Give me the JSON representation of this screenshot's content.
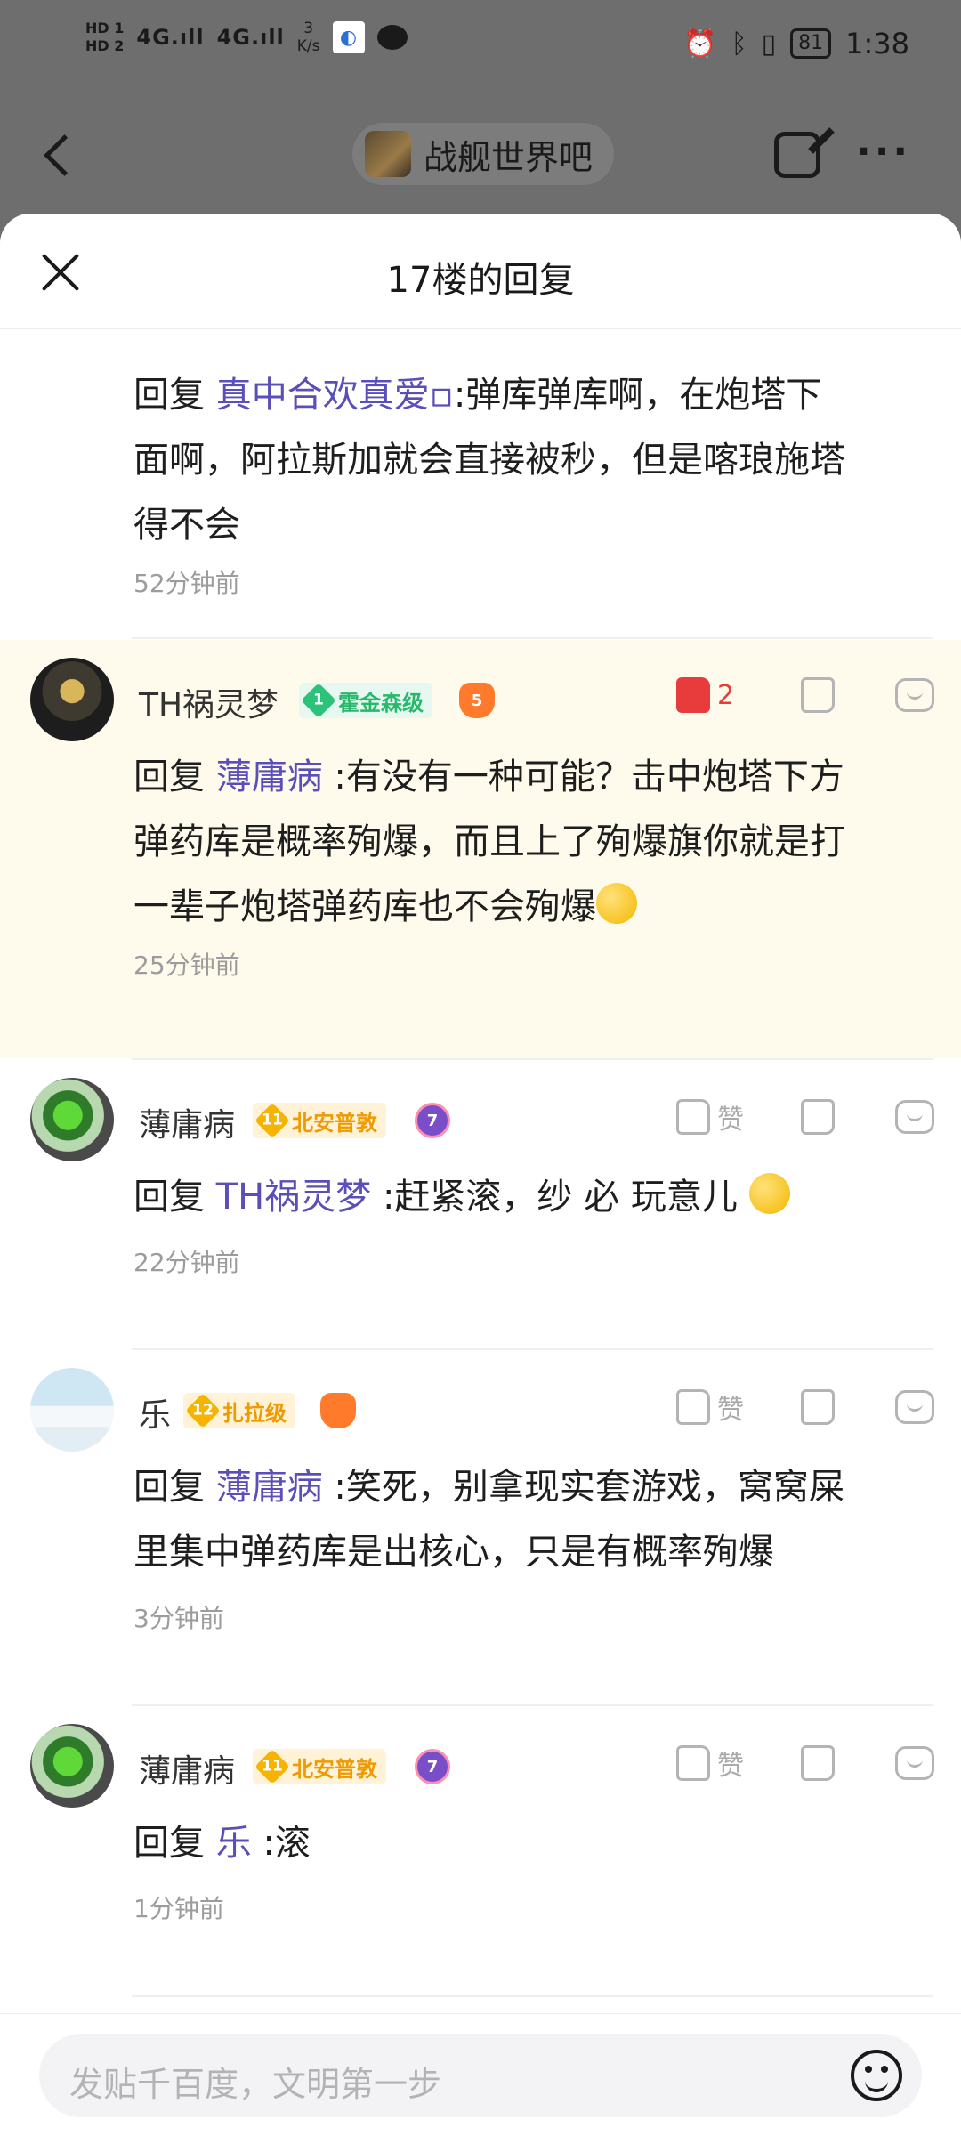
{
  "status_bar": {
    "hd1": "HD 1",
    "hd2": "HD 2",
    "signal1": "4G.ıll",
    "signal2": "4G.ıll",
    "speed_value": "3",
    "speed_unit": "K/s",
    "battery": "81",
    "time": "1:38",
    "icons": [
      "alarm-icon",
      "bluetooth-icon",
      "vibrate-icon",
      "battery-icon"
    ]
  },
  "nav": {
    "forum_name": "战舰世界吧"
  },
  "sheet": {
    "title": "17楼的回复"
  },
  "replies": [
    {
      "reply_prefix": "回复 ",
      "mention": "真中合欢真爱▫",
      "text_lines": [
        ":弹库弹库啊，在炮塔下",
        "面啊，阿拉斯加就会直接被秒，但是喀琅施塔",
        "得不会"
      ],
      "time": "52分钟前"
    },
    {
      "username": "TH祸灵梦",
      "level": "1",
      "badge": "霍金森级",
      "game_level": "5",
      "likes": "2",
      "reply_prefix": "回复 ",
      "mention": "薄庸病",
      "text_lines": [
        " :有没有一种可能？击中炮塔下方",
        "弹药库是概率殉爆，而且上了殉爆旗你就是打",
        "一辈子炮塔弹药库也不会殉爆"
      ],
      "time": "25分钟前"
    },
    {
      "username": "薄庸病",
      "level": "11",
      "badge": "北安普敦",
      "game_level": "7",
      "like_label": "赞",
      "reply_prefix": "回复 ",
      "mention": "TH祸灵梦",
      "text_lines": [
        " :赶紧滚，纱 必 玩意儿"
      ],
      "time": "22分钟前"
    },
    {
      "username": "乐",
      "level": "12",
      "badge": "扎拉级",
      "like_label": "赞",
      "reply_prefix": "回复 ",
      "mention": "薄庸病",
      "text_lines": [
        " :笑死，别拿现实套游戏，窝窝屎",
        "里集中弹药库是出核心，只是有概率殉爆"
      ],
      "time": "3分钟前"
    },
    {
      "username": "薄庸病",
      "level": "11",
      "badge": "北安普敦",
      "game_level": "7",
      "like_label": "赞",
      "reply_prefix": "回复 ",
      "mention": "乐",
      "text_lines": [
        " :滚"
      ],
      "time": "1分钟前"
    }
  ],
  "input": {
    "placeholder": "发贴千百度，文明第一步"
  },
  "colors": {
    "mention": "#5a4fb8",
    "like_active": "#e83b3b",
    "highlight_bg": "#fffbec"
  }
}
